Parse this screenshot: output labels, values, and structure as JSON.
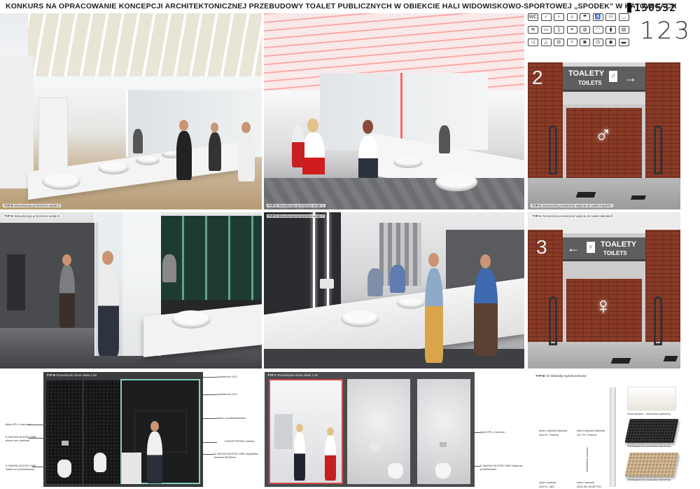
{
  "header": {
    "title": "KONKURS NA OPRACOWANIE KONCEPCJI ARCHITEKTONICZNEJ PRZEBUDOWY TOALET PUBLICZNYCH W OBIEKCIE HALI WIDOWISKOWO-SPORTOWEJ „SPODEK\" W KATOWICACH",
    "entry_code": "150532"
  },
  "panels": {
    "typ_e": {
      "type": "TYP E",
      "desc": "Wizualizacja przestrzeni wstęk E"
    },
    "typ_c": {
      "type": "TYP C",
      "desc": "Wizualizacja przestrzeni wstęk C"
    },
    "typ_d": {
      "type": "TYP D",
      "desc": "Wizualizacja przestrzeni wstęk D"
    },
    "typ_f": {
      "type": "TYP C",
      "desc": "Wizualizacja przestrzeni wstęk F"
    },
    "typ_a1": {
      "type": "TYP A",
      "desc": "Oznaczenie przestrzeni wejścia do toalet męskich"
    },
    "typ_a2": {
      "type": "TYP A",
      "desc": "Oznaczenie przestrzeni wejścia do toalet damskich"
    }
  },
  "signage": {
    "sign1_number": "2",
    "sign1_title": "TOALETY",
    "sign1_sub": "TOILETS",
    "sign1_arrow": "→",
    "sign2_number": "3",
    "sign2_title": "TOALETY",
    "sign2_sub": "TOILETS",
    "sign2_arrow": "←",
    "number_font_display": "123"
  },
  "section_b": {
    "header": "TYP B",
    "header_desc": "Rozwinięcie ścian skala 1:20",
    "labels_left": [
      "płyta HPL z wzorem",
      "IL BAGNO ALESSI ONE pisuar bez płukowy",
      "IL BAGNO ALESSI ONE miska wc podwieszana"
    ],
    "labels_right": [
      "oświetlenie LED",
      "oświetlenie LED",
      "lustro z podświetleniem",
      "CURVETRONIC bateria",
      "IL BAGNO ALESSI ONE umywalka blatowa 50x50cm"
    ]
  },
  "section_c": {
    "header": "TYP C",
    "header_desc": "Rozwinięcie ścian skala 1:20",
    "labels_right": [
      "płyta HPL z wzorem",
      "IL BAGNO ALESSI ONE miska wc podwieszana"
    ]
  },
  "materials": {
    "header": "TYP B i C",
    "header_desc": "Materiały wykończeniowe",
    "items": [
      {
        "name": "Abet Laminati Kalestra",
        "code": "408 Frr. Sharda"
      },
      {
        "name": "Abet Laminati Kalestra",
        "code": "421 Frr. Sharda"
      },
      {
        "name": "Abet Laminati",
        "code": "408 Frr. 383"
      },
      {
        "name": "Abet Laminati",
        "code": "2802 BK NOIR POL"
      }
    ],
    "vertical_label": "Oświetlenie ścienne",
    "swatch_labels": [
      "Solid surface - mineralno-żywiczny",
      "Wielkopłytowa posadzka kamienna",
      "Wielkopłytowa posadzka kamienna"
    ]
  },
  "icons": [
    "wc-icon",
    "man-icon",
    "woman-icon",
    "baby-icon",
    "shower-icon",
    "wheelchair-icon",
    "family-icon",
    "sink-icon",
    "hand-dryer-icon",
    "mirror-icon",
    "trash-icon",
    "towel-icon",
    "soap-icon",
    "wifi-icon",
    "phone-icon",
    "ticket-icon",
    "speaker-icon",
    "hanger-icon",
    "bag-icon",
    "diaper-icon",
    "camera-icon",
    "clock-icon",
    "pin-icon",
    "card-icon"
  ]
}
